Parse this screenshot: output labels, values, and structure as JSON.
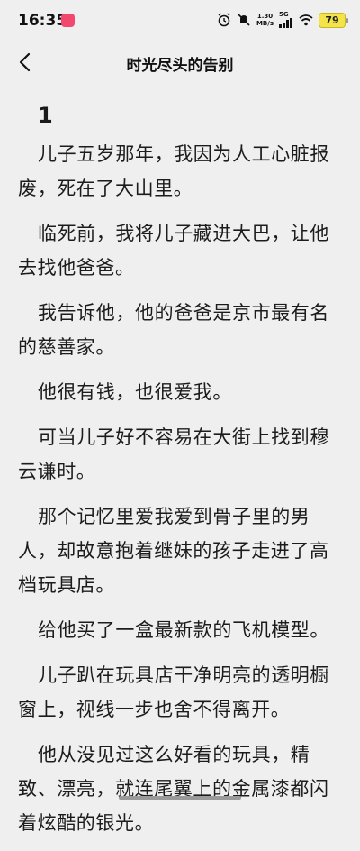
{
  "status_bar": {
    "time": "16:35",
    "net_speed_value": "1.30",
    "net_speed_unit": "MB/s",
    "network": "5G",
    "battery": "79"
  },
  "nav": {
    "title": "时光尽头的告别"
  },
  "chapter": {
    "number": "1",
    "paragraphs": [
      "儿子五岁那年，我因为人工心脏报废，死在了大山里。",
      "临死前，我将儿子藏进大巴，让他去找他爸爸。",
      "我告诉他，他的爸爸是京市最有名的慈善家。",
      "他很有钱，也很爱我。",
      "可当儿子好不容易在大街上找到穆云谦时。",
      "那个记忆里爱我爱到骨子里的男人，却故意抱着继妹的孩子走进了高档玩具店。",
      "给他买了一盒最新款的飞机模型。",
      "儿子趴在玩具店干净明亮的透明橱窗上，视线一步也舍不得离开。",
      "他从没见过这么好看的玩具，精致、漂亮，就连尾翼上的金属漆都闪着炫酷的银光。"
    ]
  },
  "colors": {
    "background": "#efefef",
    "battery": "#f4e44a",
    "app_badge": "#f2486e"
  }
}
